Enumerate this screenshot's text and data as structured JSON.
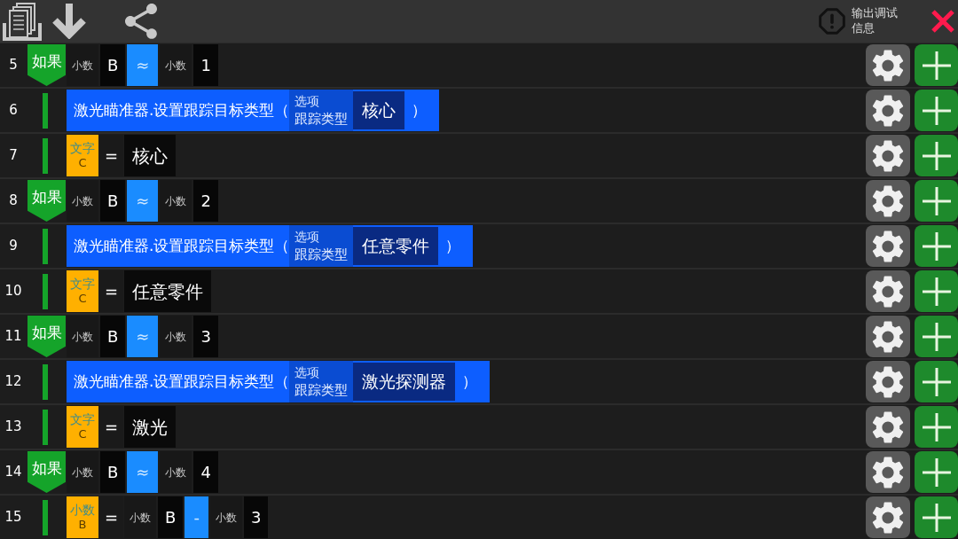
{
  "toolbar": {
    "debug_button": {
      "label": "输出调试信息"
    }
  },
  "rows": [
    {
      "line": "5",
      "kind": "if",
      "keyword": "如果",
      "condition": {
        "left": {
          "type": "小数",
          "value": "B"
        },
        "operator": "≈",
        "right": {
          "type": "小数",
          "value": "1"
        }
      },
      "children": [
        {
          "line": "6",
          "kind": "call",
          "text": "激光瞄准器.设置跟踪目标类型（",
          "param": {
            "label": "选项",
            "name": "跟踪类型",
            "value": "核心"
          },
          "close": "）"
        },
        {
          "line": "7",
          "kind": "assign",
          "target": {
            "type": "文字",
            "name": "C"
          },
          "operator": "=",
          "value": {
            "kind": "literal",
            "text": "核心"
          }
        }
      ]
    },
    {
      "line": "8",
      "kind": "if",
      "keyword": "如果",
      "condition": {
        "left": {
          "type": "小数",
          "value": "B"
        },
        "operator": "≈",
        "right": {
          "type": "小数",
          "value": "2"
        }
      },
      "children": [
        {
          "line": "9",
          "kind": "call",
          "text": "激光瞄准器.设置跟踪目标类型（",
          "param": {
            "label": "选项",
            "name": "跟踪类型",
            "value": "任意零件"
          },
          "close": "）"
        },
        {
          "line": "10",
          "kind": "assign",
          "target": {
            "type": "文字",
            "name": "C"
          },
          "operator": "=",
          "value": {
            "kind": "literal",
            "text": "任意零件"
          }
        }
      ]
    },
    {
      "line": "11",
      "kind": "if",
      "keyword": "如果",
      "condition": {
        "left": {
          "type": "小数",
          "value": "B"
        },
        "operator": "≈",
        "right": {
          "type": "小数",
          "value": "3"
        }
      },
      "children": [
        {
          "line": "12",
          "kind": "call",
          "text": "激光瞄准器.设置跟踪目标类型（",
          "param": {
            "label": "选项",
            "name": "跟踪类型",
            "value": "激光探测器"
          },
          "close": "）"
        },
        {
          "line": "13",
          "kind": "assign",
          "target": {
            "type": "文字",
            "name": "C"
          },
          "operator": "=",
          "value": {
            "kind": "literal",
            "text": "激光"
          }
        }
      ]
    },
    {
      "line": "14",
      "kind": "if",
      "keyword": "如果",
      "condition": {
        "left": {
          "type": "小数",
          "value": "B"
        },
        "operator": "≈",
        "right": {
          "type": "小数",
          "value": "4"
        }
      },
      "children": [
        {
          "line": "15",
          "kind": "assign",
          "target": {
            "type": "小数",
            "name": "B"
          },
          "operator": "=",
          "value": {
            "kind": "binary",
            "left": {
              "type": "小数",
              "value": "B"
            },
            "operator": "-",
            "right": {
              "type": "小数",
              "value": "3"
            }
          }
        }
      ]
    }
  ]
}
